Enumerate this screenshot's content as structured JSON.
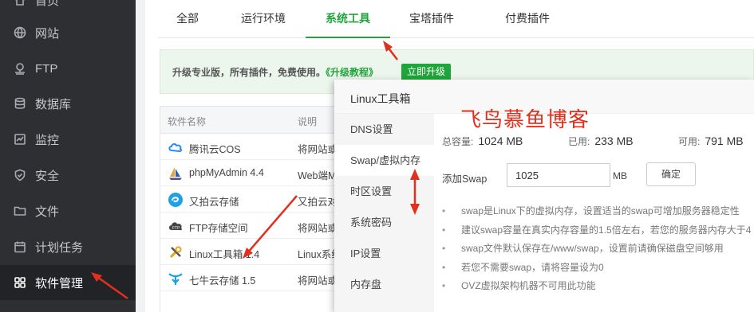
{
  "sidebar": {
    "items": [
      {
        "label": "首页",
        "icon": "home-icon"
      },
      {
        "label": "网站",
        "icon": "globe-icon"
      },
      {
        "label": "FTP",
        "icon": "ftp-icon"
      },
      {
        "label": "数据库",
        "icon": "database-icon"
      },
      {
        "label": "监控",
        "icon": "monitor-icon"
      },
      {
        "label": "安全",
        "icon": "shield-icon"
      },
      {
        "label": "文件",
        "icon": "folder-icon"
      },
      {
        "label": "计划任务",
        "icon": "calendar-icon"
      },
      {
        "label": "软件管理",
        "icon": "apps-icon"
      }
    ],
    "active": "软件管理"
  },
  "tabs": [
    "全部",
    "运行环境",
    "系统工具",
    "宝塔插件",
    "付费插件"
  ],
  "active_tab": "系统工具",
  "banner": {
    "text": "升级专业版，所有插件，免费使用。",
    "link": "《升级教程》",
    "button": "立即升级"
  },
  "table": {
    "headers": [
      "软件名称",
      "说明"
    ],
    "rows": [
      {
        "name": "腾讯云COS",
        "desc": "将网站或",
        "icon": "cloud-icon"
      },
      {
        "name": "phpMyAdmin 4.4",
        "desc": "Web端M",
        "icon": "sailboat-icon"
      },
      {
        "name": "又拍云存储",
        "desc": "又拍云对",
        "icon": "upyun-icon"
      },
      {
        "name": "FTP存储空间",
        "desc": "将网站或",
        "icon": "ftp-cloud-icon"
      },
      {
        "name": "Linux工具箱 1.4",
        "desc": "Linux系统",
        "icon": "tools-icon"
      },
      {
        "name": "七牛云存储 1.5",
        "desc": "将网站或",
        "icon": "qiniu-icon"
      }
    ]
  },
  "dialog": {
    "title": "Linux工具箱",
    "menu": [
      "DNS设置",
      "Swap/虚拟内存",
      "时区设置",
      "系统密码",
      "IP设置",
      "内存盘"
    ],
    "active_menu": "Swap/虚拟内存",
    "stats": {
      "total_label": "总容量:",
      "total": "1024 MB",
      "used_label": "已用:",
      "used": "233 MB",
      "free_label": "可用:",
      "free": "791 MB"
    },
    "swap_label": "添加Swap",
    "swap_value": "1025",
    "swap_unit": "MB",
    "confirm": "确定",
    "tips": [
      "swap是Linux下的虚拟内存，设置适当的swap可增加服务器稳定性",
      "建议swap容量在真实内存容量的1.5倍左右，若您的服务器内存大于4",
      "swap文件默认保存在/www/swap，设置前请确保磁盘空间够用",
      "若您不需要swap，请将容量设为0",
      "OVZ虚拟架构机器不可用此功能"
    ]
  },
  "watermark": "飞鸟慕鱼博客",
  "colors": {
    "accent": "#20a53a",
    "sidebar": "#2d2f33",
    "annotation": "#e0301e"
  }
}
